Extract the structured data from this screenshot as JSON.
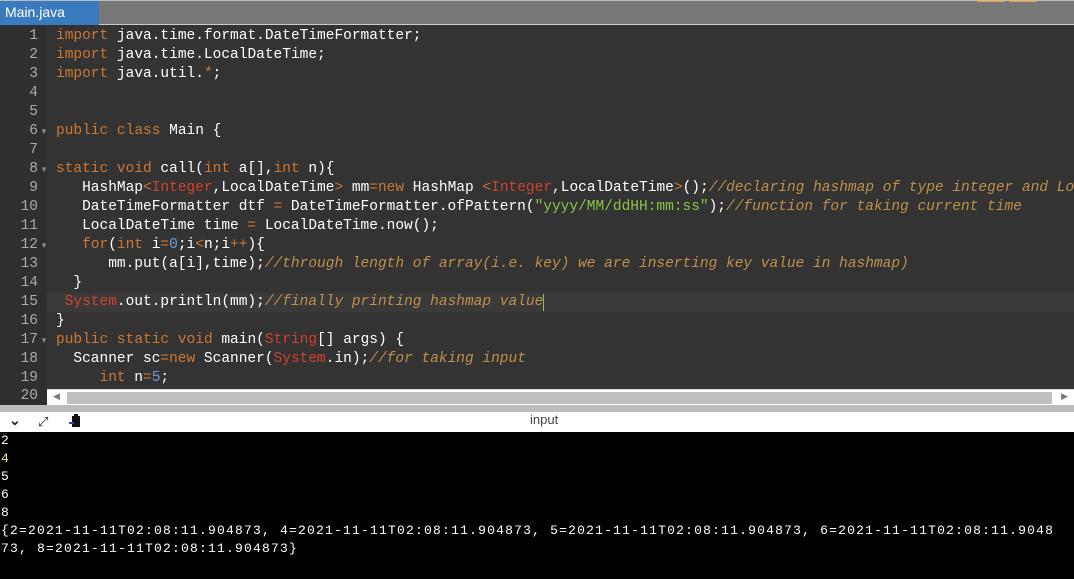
{
  "tab": {
    "label": "Main.java"
  },
  "editor": {
    "active_line": 15,
    "lines": [
      {
        "n": "1",
        "indent": 0,
        "tokens": [
          [
            "kw",
            "import"
          ],
          [
            "",
            "java.time.format.DateTimeFormatter;"
          ]
        ]
      },
      {
        "n": "2",
        "indent": 0,
        "tokens": [
          [
            "kw",
            "import"
          ],
          [
            "",
            "java.time.LocalDateTime;"
          ]
        ]
      },
      {
        "n": "3",
        "indent": 0,
        "tokens": [
          [
            "kw",
            "import"
          ],
          [
            "",
            "java.util."
          ],
          [
            "op",
            "*"
          ],
          [
            "",
            ";"
          ]
        ]
      },
      {
        "n": "4",
        "indent": 0,
        "tokens": []
      },
      {
        "n": "5",
        "indent": 0,
        "tokens": []
      },
      {
        "n": "6",
        "indent": 0,
        "fold": true,
        "tokens": [
          [
            "kw",
            "public"
          ],
          [
            "",
            " "
          ],
          [
            "kw",
            "class"
          ],
          [
            "",
            " Main {"
          ]
        ]
      },
      {
        "n": "7",
        "indent": 0,
        "tokens": []
      },
      {
        "n": "8",
        "indent": 0,
        "fold": true,
        "tokens": [
          [
            "kw",
            "static"
          ],
          [
            "",
            " "
          ],
          [
            "kw",
            "void"
          ],
          [
            "",
            " call("
          ],
          [
            "kw",
            "int"
          ],
          [
            "",
            " a[],"
          ],
          [
            "kw",
            "int"
          ],
          [
            "",
            " n){"
          ]
        ]
      },
      {
        "n": "9",
        "indent": 3,
        "tokens": [
          [
            "",
            "HashMap"
          ],
          [
            "op",
            "<"
          ],
          [
            "ty",
            "Integer"
          ],
          [
            "",
            ",LocalDateTime"
          ],
          [
            "op",
            ">"
          ],
          [
            "",
            " mm"
          ],
          [
            "op",
            "="
          ],
          [
            "kw",
            "new"
          ],
          [
            "",
            " HashMap "
          ],
          [
            "op",
            "<"
          ],
          [
            "ty",
            "Integer"
          ],
          [
            "",
            ",LocalDateTime"
          ],
          [
            "op",
            ">"
          ],
          [
            "",
            "();"
          ],
          [
            "cm",
            "//declaring hashmap of type integer and LocalDateTime"
          ]
        ]
      },
      {
        "n": "10",
        "indent": 3,
        "tokens": [
          [
            "",
            "DateTimeFormatter dtf "
          ],
          [
            "op",
            "="
          ],
          [
            "",
            " DateTimeFormatter.ofPattern("
          ],
          [
            "st",
            "\"yyyy/MM/ddHH:mm:ss\""
          ],
          [
            "",
            ");"
          ],
          [
            "cm",
            "//function for taking current time"
          ]
        ]
      },
      {
        "n": "11",
        "indent": 3,
        "tokens": [
          [
            "",
            "LocalDateTime time "
          ],
          [
            "op",
            "="
          ],
          [
            "",
            " LocalDateTime.now();"
          ]
        ]
      },
      {
        "n": "12",
        "indent": 3,
        "fold": true,
        "tokens": [
          [
            "kw",
            "for"
          ],
          [
            "",
            "("
          ],
          [
            "kw",
            "int"
          ],
          [
            "",
            " i"
          ],
          [
            "op",
            "="
          ],
          [
            "nm",
            "0"
          ],
          [
            "",
            ";i"
          ],
          [
            "op",
            "<"
          ],
          [
            "",
            "n;i"
          ],
          [
            "op",
            "++"
          ],
          [
            "",
            "){"
          ]
        ]
      },
      {
        "n": "13",
        "indent": 6,
        "tokens": [
          [
            "",
            "mm.put(a[i],time);"
          ],
          [
            "cm",
            "//through length of array(i.e. key) we are inserting key value in hashmap)"
          ]
        ]
      },
      {
        "n": "14",
        "indent": 2,
        "tokens": [
          [
            "",
            "}"
          ]
        ]
      },
      {
        "n": "15",
        "indent": 1,
        "tokens": [
          [
            "ty",
            "System"
          ],
          [
            "",
            ".out.println(mm);"
          ],
          [
            "cm",
            "//finally printing hashmap value"
          ]
        ]
      },
      {
        "n": "16",
        "indent": 0,
        "tokens": [
          [
            "",
            "}"
          ]
        ]
      },
      {
        "n": "17",
        "indent": 0,
        "fold": true,
        "tokens": [
          [
            "kw",
            "public"
          ],
          [
            "",
            " "
          ],
          [
            "kw",
            "static"
          ],
          [
            "",
            " "
          ],
          [
            "kw",
            "void"
          ],
          [
            "",
            " main("
          ],
          [
            "ty",
            "String"
          ],
          [
            "",
            "[] args) {"
          ]
        ]
      },
      {
        "n": "18",
        "indent": 2,
        "tokens": [
          [
            "",
            "Scanner sc"
          ],
          [
            "op",
            "="
          ],
          [
            "kw",
            "new"
          ],
          [
            "",
            " Scanner("
          ],
          [
            "ty",
            "System"
          ],
          [
            "",
            ".in);"
          ],
          [
            "cm",
            "//for taking input"
          ]
        ]
      },
      {
        "n": "19",
        "indent": 5,
        "tokens": [
          [
            "kw",
            "int"
          ],
          [
            "",
            " n"
          ],
          [
            "op",
            "="
          ],
          [
            "nm",
            "5"
          ],
          [
            "",
            ";"
          ]
        ]
      }
    ],
    "last_line_number": "20"
  },
  "toolbar": {
    "input_label": "input"
  },
  "output": {
    "lines": [
      "2",
      "4",
      "5",
      "6",
      "8",
      "{2=2021-11-11T02:08:11.904873, 4=2021-11-11T02:08:11.904873, 5=2021-11-11T02:08:11.904873, 6=2021-11-11T02:08:11.9048",
      "73, 8=2021-11-11T02:08:11.904873}"
    ],
    "highlight_line_color": "#ffe680"
  }
}
